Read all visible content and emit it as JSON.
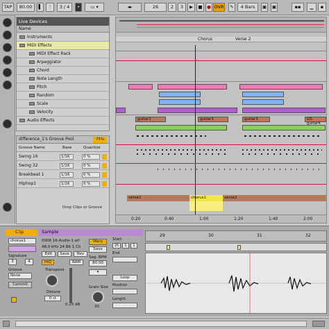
{
  "transport": {
    "tap": "TAP",
    "tempo": "80.00",
    "sig": "3 / 4",
    "pos1": "26",
    "pos2": "2",
    "pos3": "3",
    "ovr": "OVR",
    "bars": "4 Bars"
  },
  "browser": {
    "header": "Live Devices",
    "col": "Name",
    "items": [
      "Instruments",
      "MIDI Effects",
      "MIDI Effect Rack",
      "Arpeggiator",
      "Chord",
      "Note Length",
      "Pitch",
      "Random",
      "Scale",
      "Velocity",
      "Audio Effects"
    ]
  },
  "groove": {
    "title": "difference_1's Groove Pool",
    "zoom": "75%",
    "cols": [
      "Groove Name",
      "Base",
      "Quantize"
    ],
    "rows": [
      {
        "name": "Swing 16",
        "base": "1/16",
        "q": "0 %"
      },
      {
        "name": "Swing 32",
        "base": "1/16",
        "q": "0 %"
      },
      {
        "name": "Breakbeat 1",
        "base": "1/16",
        "q": "0 %"
      },
      {
        "name": "Hiphop1",
        "base": "1/16",
        "q": "0 %"
      }
    ],
    "drop": "Drop Clips or Groove"
  },
  "arrangement": {
    "markers": [
      "Chorus",
      "Verse 2"
    ],
    "clip_labels": [
      "guitar1",
      "guitar3",
      "guitar3",
      "G5-guitar4"
    ],
    "bottom_labels": [
      "verse1",
      "chorus1",
      "verse2"
    ],
    "time": [
      "0:20",
      "0:40",
      "1:00",
      "1:20",
      "1:40",
      "2:00"
    ]
  },
  "clipview": {
    "clip": "Clip",
    "name": "chorus1",
    "signature": "Signature",
    "sig_a": "3",
    "sig_b": "4",
    "groove": "Groove",
    "groove_val": "None",
    "commit": "Commit",
    "sample": "Sample",
    "file": "0006 16-Audio-1.aif",
    "rate": "48.0 kHz 24 Bit 1 Ch",
    "edit": "Edit",
    "save": "Save",
    "rev": "Rev",
    "hiq": "HiQ",
    "ram": "RAM",
    "transpose": "Transpose",
    "detune": "Detune",
    "detune_val": "0 ct",
    "gain": "0.25 dB",
    "warp": "Warp",
    "seg_bpm": "Seg. BPM",
    "bpm": "80.00",
    "grain": "Grain Size",
    "grain_val": "30",
    "start": "Start",
    "end": "End",
    "loop": "Loop",
    "position": "Position",
    "length": "Length",
    "st1": "25",
    "st2": "1",
    "st3": "1",
    "ruler": [
      "29",
      "30",
      "31",
      "32"
    ]
  },
  "colors": {
    "pink": "#f07ab4",
    "blue": "#7fb4f0",
    "purple": "#b45ad2",
    "green": "#8ad25a",
    "brown": "#b47a5a",
    "yellow": "#f0e64a"
  }
}
